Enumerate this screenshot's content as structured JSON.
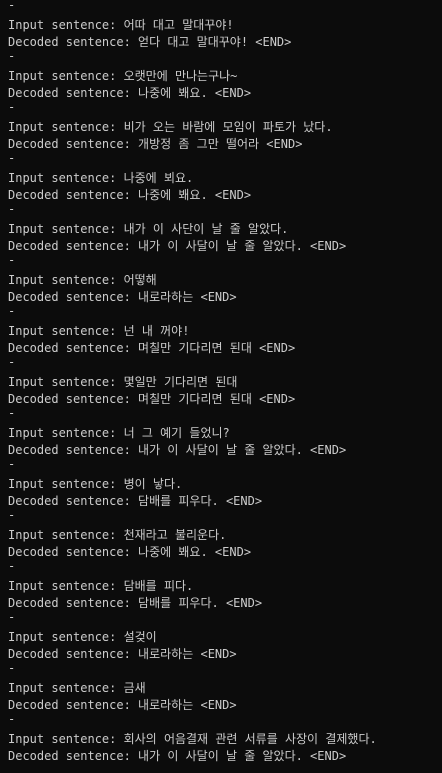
{
  "console": {
    "background": "#0c0c0c",
    "foreground": "#cccccc",
    "separator": "-",
    "input_prefix": "Input sentence: ",
    "decoded_prefix": "Decoded sentence: ",
    "end_token": "<END>",
    "lines": [
      {
        "kind": "sep",
        "text": "-"
      },
      {
        "kind": "text",
        "text": "Input sentence: 어따 대고 말대꾸야!"
      },
      {
        "kind": "text",
        "text": "Decoded sentence: 얻다 대고 말대꾸야! <END>"
      },
      {
        "kind": "sep",
        "text": "-"
      },
      {
        "kind": "text",
        "text": "Input sentence: 오랫만에 만나는구나~"
      },
      {
        "kind": "text",
        "text": "Decoded sentence: 나중에 봬요. <END>"
      },
      {
        "kind": "sep",
        "text": "-"
      },
      {
        "kind": "text",
        "text": "Input sentence: 비가 오는 바람에 모임이 파토가 났다."
      },
      {
        "kind": "text",
        "text": "Decoded sentence: 개방정 좀 그만 떨어라 <END>"
      },
      {
        "kind": "sep",
        "text": "-"
      },
      {
        "kind": "text",
        "text": "Input sentence: 나중에 뵈요."
      },
      {
        "kind": "text",
        "text": "Decoded sentence: 나중에 봬요. <END>"
      },
      {
        "kind": "sep",
        "text": "-"
      },
      {
        "kind": "text",
        "text": "Input sentence: 내가 이 사단이 날 줄 알았다."
      },
      {
        "kind": "text",
        "text": "Decoded sentence: 내가 이 사달이 날 줄 알았다. <END>"
      },
      {
        "kind": "sep",
        "text": "-"
      },
      {
        "kind": "text",
        "text": "Input sentence: 어떻해"
      },
      {
        "kind": "text",
        "text": "Decoded sentence: 내로라하는 <END>"
      },
      {
        "kind": "sep",
        "text": "-"
      },
      {
        "kind": "text",
        "text": "Input sentence: 넌 내 꺼야!"
      },
      {
        "kind": "text",
        "text": "Decoded sentence: 며칠만 기다리면 된대 <END>"
      },
      {
        "kind": "sep",
        "text": "-"
      },
      {
        "kind": "text",
        "text": "Input sentence: 몇일만 기다리면 된대"
      },
      {
        "kind": "text",
        "text": "Decoded sentence: 며칠만 기다리면 된대 <END>"
      },
      {
        "kind": "sep",
        "text": "-"
      },
      {
        "kind": "text",
        "text": "Input sentence: 너 그 예기 들었니?"
      },
      {
        "kind": "text",
        "text": "Decoded sentence: 내가 이 사달이 날 줄 알았다. <END>"
      },
      {
        "kind": "sep",
        "text": "-"
      },
      {
        "kind": "text",
        "text": "Input sentence: 병이 낳다."
      },
      {
        "kind": "text",
        "text": "Decoded sentence: 담배를 피우다. <END>"
      },
      {
        "kind": "sep",
        "text": "-"
      },
      {
        "kind": "text",
        "text": "Input sentence: 천재라고 불리운다."
      },
      {
        "kind": "text",
        "text": "Decoded sentence: 나중에 봬요. <END>"
      },
      {
        "kind": "sep",
        "text": "-"
      },
      {
        "kind": "text",
        "text": "Input sentence: 담배를 피다."
      },
      {
        "kind": "text",
        "text": "Decoded sentence: 담배를 피우다. <END>"
      },
      {
        "kind": "sep",
        "text": "-"
      },
      {
        "kind": "text",
        "text": "Input sentence: 설겆이"
      },
      {
        "kind": "text",
        "text": "Decoded sentence: 내로라하는 <END>"
      },
      {
        "kind": "sep",
        "text": "-"
      },
      {
        "kind": "text",
        "text": "Input sentence: 금새"
      },
      {
        "kind": "text",
        "text": "Decoded sentence: 내로라하는 <END>"
      },
      {
        "kind": "sep",
        "text": "-"
      },
      {
        "kind": "text",
        "text": "Input sentence: 회사의 어음결재 관련 서류를 사장이 결제했다."
      },
      {
        "kind": "text",
        "text": "Decoded sentence: 내가 이 사달이 날 줄 알았다. <END>"
      }
    ]
  }
}
